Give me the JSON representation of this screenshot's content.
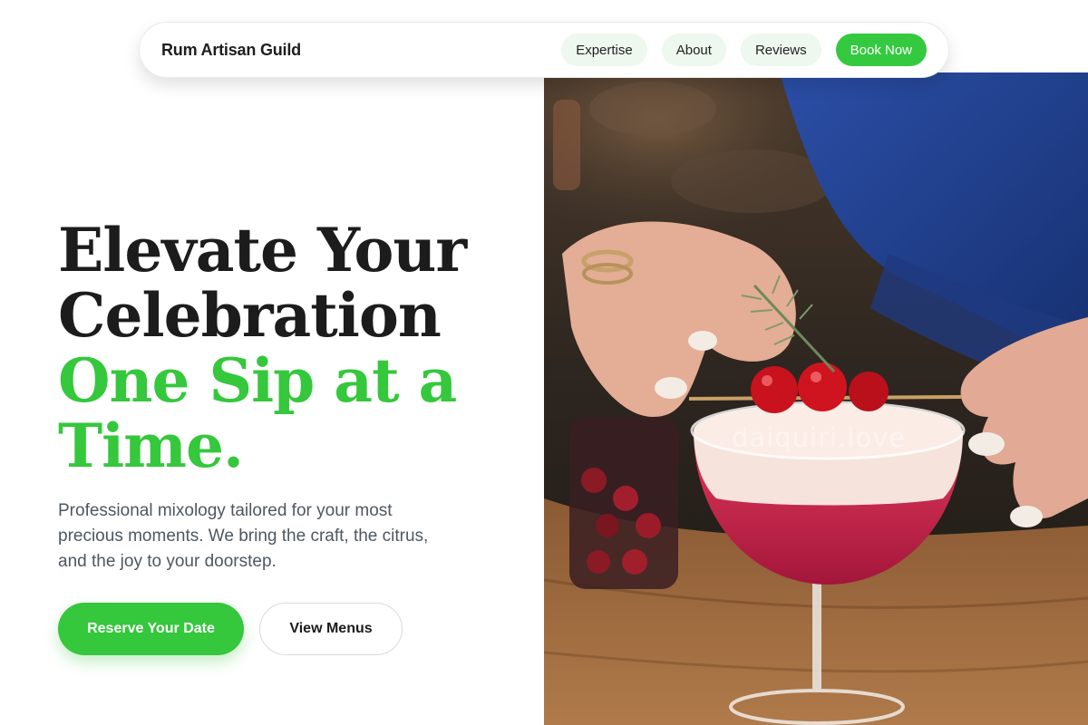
{
  "nav": {
    "brand": "Rum Artisan Guild",
    "links": [
      {
        "label": "Expertise"
      },
      {
        "label": "About"
      },
      {
        "label": "Reviews"
      }
    ],
    "cta_label": "Book Now"
  },
  "hero": {
    "headline_dark": [
      "Elevate Your",
      "Celebration"
    ],
    "headline_green": [
      "One Sip at a",
      "Time."
    ],
    "subtitle": "Professional mixology tailored for your most precious moments. We bring the craft, the citrus, and the joy to your doorstep.",
    "primary_button": "Reserve Your Date",
    "secondary_button": "View Menus"
  },
  "photo": {
    "watermark": "daiquiri.love"
  },
  "colors": {
    "accent": "#35c73c",
    "text_dark": "#1c1c1c",
    "text_muted": "#4e5761",
    "pill_bg": "#eef8ee"
  }
}
